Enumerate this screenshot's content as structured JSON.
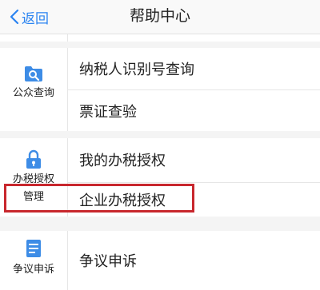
{
  "nav": {
    "back_label": "返回",
    "title": "帮助中心"
  },
  "sections": [
    {
      "category": "公众查询",
      "icon": "magnifier-icon",
      "items": [
        "纳税人识别号查询",
        "票证查验"
      ]
    },
    {
      "category_line1": "办税授权",
      "category_line2": "管理",
      "icon": "lock-icon",
      "items": [
        "我的办税授权",
        "企业办税授权"
      ]
    },
    {
      "category": "争议申诉",
      "icon": "document-icon",
      "items": [
        "争议申诉"
      ]
    }
  ],
  "highlight_color": "#c8272d",
  "accent_color": "#2b84f1"
}
